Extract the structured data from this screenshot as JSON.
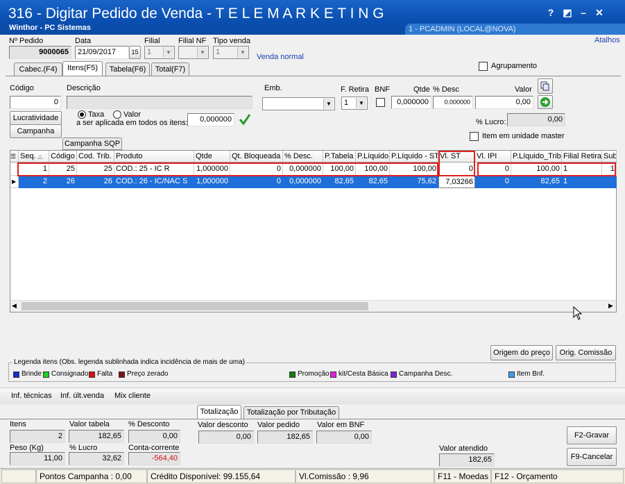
{
  "window": {
    "title": "316 - Digitar Pedido de Venda - T E L E M A R K E T I N G",
    "subtitle": "Winthor - PC Sistemas",
    "user": "1 - PCADMIN (LOCAL@NOVA)",
    "controls": [
      "?",
      "◩",
      "–",
      "✕"
    ]
  },
  "header": {
    "pedido_label": "Nº Pedido",
    "pedido_value": "9000065",
    "data_label": "Data",
    "data_value": "21/09/2017",
    "filial_label": "Filial",
    "filial_value": "1",
    "filialnf_label": "Filial NF",
    "tipovenda_label": "Tipo venda",
    "tipovenda_value": "1",
    "venda_tipo": "Venda normal",
    "atalhos": "Atalhos",
    "agrupamento": "Agrupamento"
  },
  "tabs": [
    {
      "label": "Cabec.(F4)"
    },
    {
      "label": "Itens(F5)"
    },
    {
      "label": "Tabela(F6)"
    },
    {
      "label": "Total(F7)"
    }
  ],
  "form": {
    "codigo_label": "Código",
    "codigo_value": "0",
    "descricao_label": "Descrição",
    "emb_label": "Emb.",
    "fretira_label": "F. Retira",
    "fretira_value": "1",
    "bnf_label": "BNF",
    "qtde_label": "Qtde",
    "qtde_value": "0,000000",
    "pdesc_label": "% Desc",
    "pdesc_value": "0.000000",
    "valor_label": "Valor",
    "valor_value": "0,00",
    "plucro_label": "% Lucro:",
    "plucro_value": "0,00",
    "item_master": "Item em unidade master",
    "lucratividade": "Lucratividade",
    "campanha": "Campanha",
    "taxa": "Taxa",
    "valor_radio": "Valor",
    "aplicada_label": "a ser aplicada em todos os itens:",
    "aplicada_value": "0,000000",
    "campanha_sqp": "Campanha SQP"
  },
  "grid": {
    "columns": [
      "Seq.",
      "Código",
      "Cod. Trib.",
      "Produto",
      "Qtde",
      "Qt. Bloqueada",
      "% Desc.",
      "P.Tabela",
      "P.Líquido",
      "P.Líquido - ST",
      "Vl. ST",
      "Vl. IPI",
      "P.Líquido_Trib",
      "Filial Retira",
      "Sub"
    ],
    "rows": [
      [
        "1",
        "25",
        "25",
        "COD.: 25 - IC R",
        "1,000000",
        "0",
        "0,000000",
        "100,00",
        "100,00",
        "100,00",
        "0",
        "0",
        "100,00",
        "1",
        "1"
      ],
      [
        "2",
        "26",
        "26",
        "COD.: 26 - IC/NAC S",
        "1,000000",
        "0",
        "0,000000",
        "82,65",
        "82,65",
        "75,62",
        "7,03266",
        "0",
        "82,65",
        "1",
        ""
      ]
    ]
  },
  "buttons": {
    "origem_preco": "Origem do preço",
    "orig_comissao": "Orig. Comissão",
    "gravar": "F2-Gravar",
    "cancelar": "F9-Cancelar"
  },
  "legend": {
    "title": "Legenda itens (Obs. legenda sublinhada indica incidência de mais de uma)",
    "items": [
      {
        "label": "Brinde",
        "color": "#1030d0"
      },
      {
        "label": "Consignado",
        "color": "#20d020"
      },
      {
        "label": "Falta",
        "color": "#e01010"
      },
      {
        "label": "Preço zerado",
        "color": "#801010"
      },
      {
        "label": "Promoção",
        "color": "#108010"
      },
      {
        "label": "kit/Cesta Básica",
        "color": "#e020e0"
      },
      {
        "label": "Campanha Desc.",
        "color": "#8020e0"
      },
      {
        "label": "Item Bnf.",
        "color": "#40a0f0"
      }
    ]
  },
  "links": [
    "Inf. técnicas",
    "Inf. últ.venda",
    "Mix cliente"
  ],
  "bottom_tabs": [
    "Totalização",
    "Totalização por Tributação"
  ],
  "totals": {
    "itens_label": "Itens",
    "itens_value": "2",
    "valor_tabela_label": "Valor tabela",
    "valor_tabela_value": "182,65",
    "pdesconto_label": "% Desconto",
    "pdesconto_value": "0,00",
    "valor_desconto_label": "Valor desconto",
    "valor_desconto_value": "0,00",
    "valor_pedido_label": "Valor pedido",
    "valor_pedido_value": "182,65",
    "valor_bnf_label": "Valor em BNF",
    "valor_bnf_value": "0,00",
    "peso_label": "Peso (Kg)",
    "peso_value": "11,00",
    "plucro_label": "% Lucro",
    "plucro_value": "32,62",
    "cc_label": "Conta-corrente",
    "cc_value": "-564,40",
    "valor_atendido_label": "Valor atendido",
    "valor_atendido_value": "182,65"
  },
  "status": {
    "pontos": "Pontos Campanha : 0,00",
    "credito": "Crédito Disponível: 99.155,64",
    "comissao": "Vl.Comissão : 9,96",
    "moedas": "F11 - Moedas",
    "orcamento": "F12 - Orçamento"
  }
}
